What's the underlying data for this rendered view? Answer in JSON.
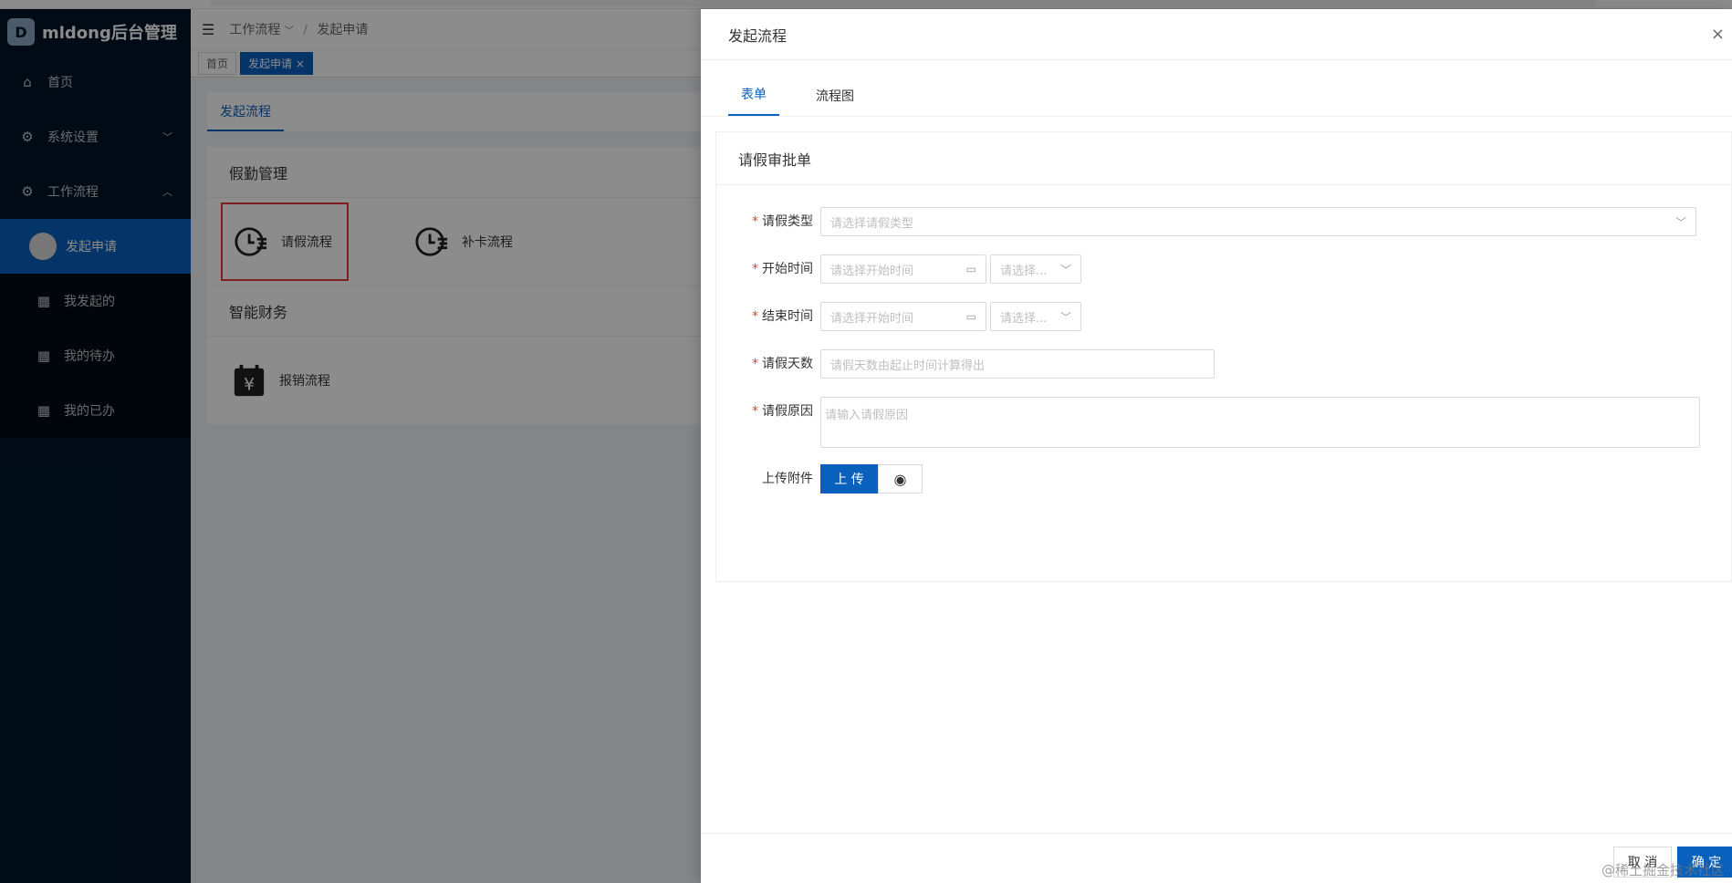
{
  "app": {
    "title": "mldong后台管理",
    "logo_letter": "D"
  },
  "sidebar": {
    "items": [
      {
        "label": "首页",
        "icon": "home-icon"
      },
      {
        "label": "系统设置",
        "icon": "gear-icon"
      },
      {
        "label": "工作流程",
        "icon": "gear-icon"
      }
    ],
    "sub_items": [
      {
        "label": "发起申请",
        "icon": "avatar",
        "active": true
      },
      {
        "label": "我发起的",
        "icon": "grid-icon"
      },
      {
        "label": "我的待办",
        "icon": "grid-icon"
      },
      {
        "label": "我的已办",
        "icon": "grid-icon"
      }
    ]
  },
  "header": {
    "breadcrumb": [
      "工作流程",
      "发起申请"
    ]
  },
  "tabs": [
    {
      "label": "首页",
      "active": false
    },
    {
      "label": "发起申请",
      "active": true,
      "close": "×"
    }
  ],
  "main": {
    "tab": "发起流程",
    "groups": [
      {
        "title": "假勤管理",
        "flows": [
          "请假流程",
          "补卡流程"
        ]
      },
      {
        "title": "智能财务",
        "flows": [
          "报销流程"
        ]
      }
    ]
  },
  "drawer": {
    "title": "发起流程",
    "close": "×",
    "tabs": [
      {
        "label": "表单",
        "active": true
      },
      {
        "label": "流程图",
        "active": false
      }
    ],
    "form_title": "请假审批单",
    "fields": {
      "leave_type": {
        "label": "请假类型",
        "required": "*",
        "placeholder": "请选择请假类型"
      },
      "start_time": {
        "label": "开始时间",
        "required": "*",
        "placeholder": "请选择开始时间",
        "select_placeholder": "请选择..."
      },
      "end_time": {
        "label": "结束时间",
        "required": "*",
        "placeholder": "请选择开始时间",
        "select_placeholder": "请选择..."
      },
      "days": {
        "label": "请假天数",
        "required": "*",
        "placeholder": "请假天数由起止时间计算得出"
      },
      "reason": {
        "label": "请假原因",
        "required": "*",
        "placeholder": "请输入请假原因"
      },
      "attachment": {
        "label": "上传附件",
        "upload": "上 传"
      }
    },
    "footer": {
      "cancel": "取 消",
      "ok": "确 定"
    }
  },
  "watermark": "@稀土掘金技术社区",
  "colors": {
    "sidebar_bg": "#001529",
    "primary": "#0960bd",
    "required": "#e53935",
    "highlight": "#e53935"
  }
}
